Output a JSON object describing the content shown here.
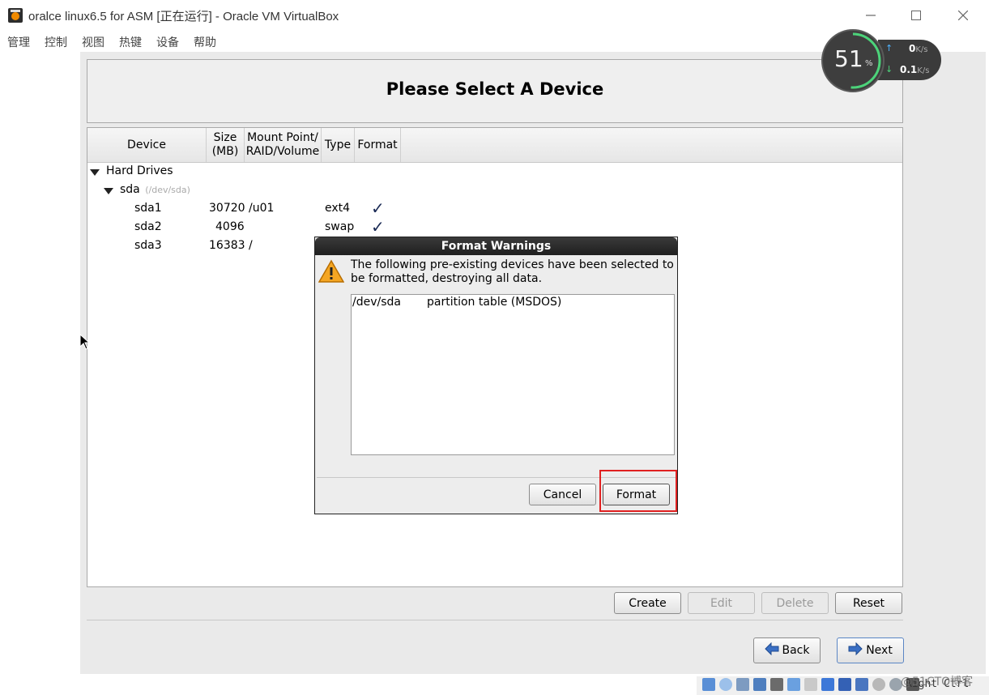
{
  "window": {
    "title": "oralce linux6.5 for ASM [正在运行] - Oracle VM VirtualBox",
    "menu": [
      "管理",
      "控制",
      "视图",
      "热键",
      "设备",
      "帮助"
    ]
  },
  "header": {
    "title": "Please Select A Device"
  },
  "tree": {
    "columns": [
      "Device",
      "Size\n(MB)",
      "Mount Point/\nRAID/Volume",
      "Type",
      "Format"
    ],
    "group_label": "Hard Drives",
    "disk": {
      "name": "sda",
      "path": "(/dev/sda)"
    },
    "rows": [
      {
        "device": "sda1",
        "size": "30720",
        "mount": "/u01",
        "type": "ext4",
        "format": "✓"
      },
      {
        "device": "sda2",
        "size": "4096",
        "mount": "",
        "type": "swap",
        "format": "✓"
      },
      {
        "device": "sda3",
        "size": "16383",
        "mount": "/",
        "type": "",
        "format": ""
      }
    ]
  },
  "dialog": {
    "title": "Format Warnings",
    "message": "The following pre-existing devices have been selected to be formatted, destroying all data.",
    "items": [
      {
        "device": "/dev/sda",
        "description": "partition table (MSDOS)"
      }
    ],
    "cancel_label": "Cancel",
    "format_label": "Format"
  },
  "actions": {
    "create": "Create",
    "edit": "Edit",
    "delete": "Delete",
    "reset": "Reset"
  },
  "nav": {
    "back": "Back",
    "next": "Next"
  },
  "widget": {
    "cpu_percent": "51",
    "percent_sign": "%",
    "up_rate": "0",
    "up_unit": "K/s",
    "down_rate": "0.1",
    "down_unit": "K/s"
  },
  "status": {
    "host_key": "Right Ctrl",
    "watermark": "@51CTO博客"
  }
}
